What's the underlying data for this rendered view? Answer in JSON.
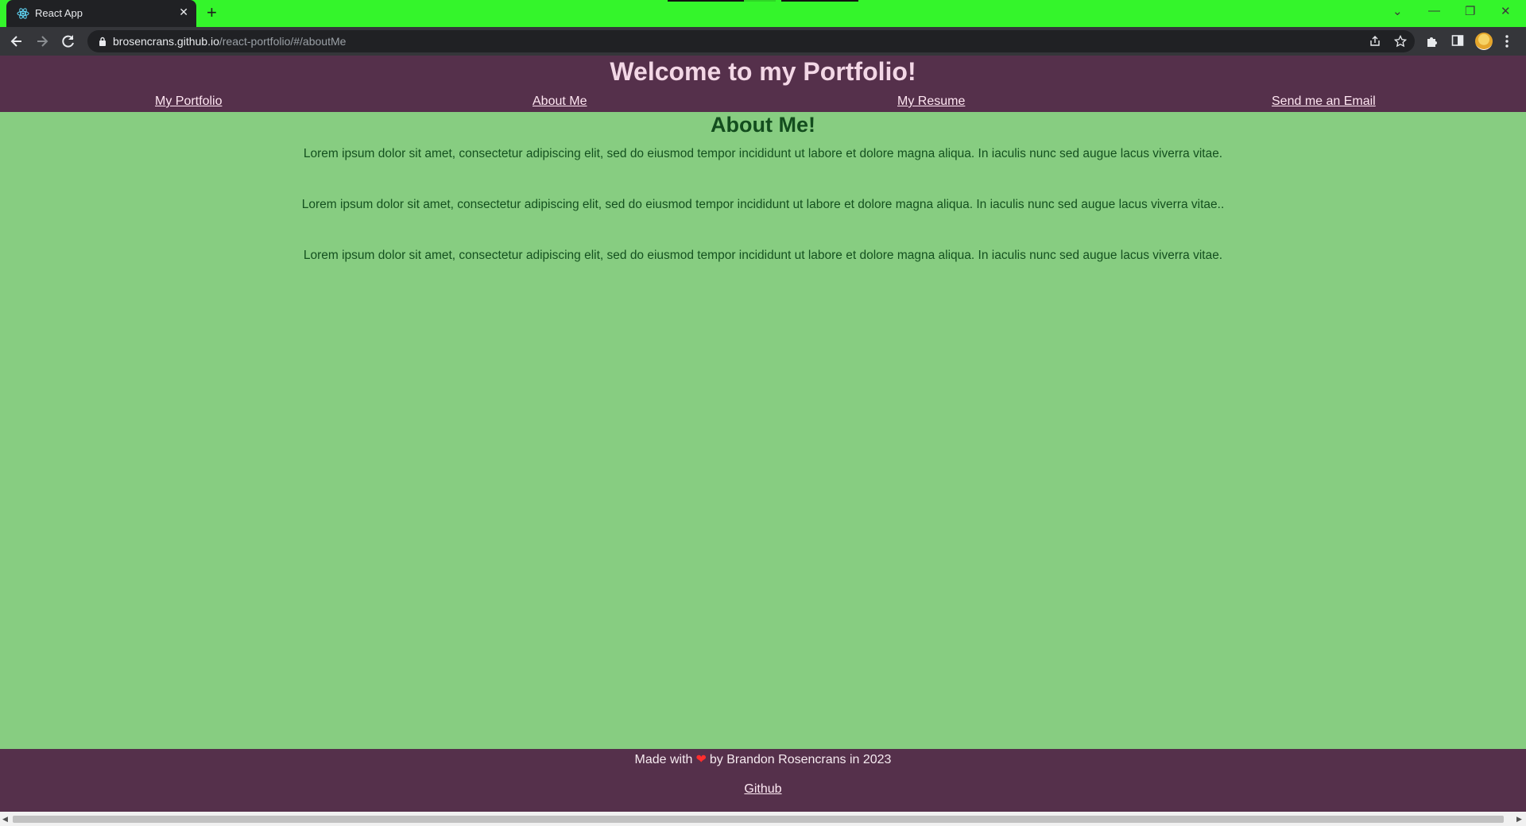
{
  "browser": {
    "tab_title": "React App",
    "tab_close": "✕",
    "new_tab": "+",
    "url_host": "brosencrans.github.io",
    "url_path": "/react-portfolio/#/aboutMe"
  },
  "site": {
    "title": "Welcome to my Portfolio!",
    "nav": [
      "My Portfolio",
      "About Me",
      "My Resume",
      "Send me an Email"
    ]
  },
  "content": {
    "heading": "About Me!",
    "paragraphs": [
      "Lorem ipsum dolor sit amet, consectetur adipiscing elit, sed do eiusmod tempor incididunt ut labore et dolore magna aliqua. In iaculis nunc sed augue lacus viverra vitae.",
      "Lorem ipsum dolor sit amet, consectetur adipiscing elit, sed do eiusmod tempor incididunt ut labore et dolore magna aliqua. In iaculis nunc sed augue lacus viverra vitae..",
      "Lorem ipsum dolor sit amet, consectetur adipiscing elit, sed do eiusmod tempor incididunt ut labore et dolore magna aliqua. In iaculis nunc sed augue lacus viverra vitae."
    ]
  },
  "footer": {
    "made_with": "Made with",
    "by_text": "by Brandon Rosencrans in 2023",
    "github": "Github"
  },
  "colors": {
    "tabbar": "#34f52b",
    "header_bg": "#55304b",
    "content_bg": "#87cd81",
    "heading": "#134d1e"
  }
}
